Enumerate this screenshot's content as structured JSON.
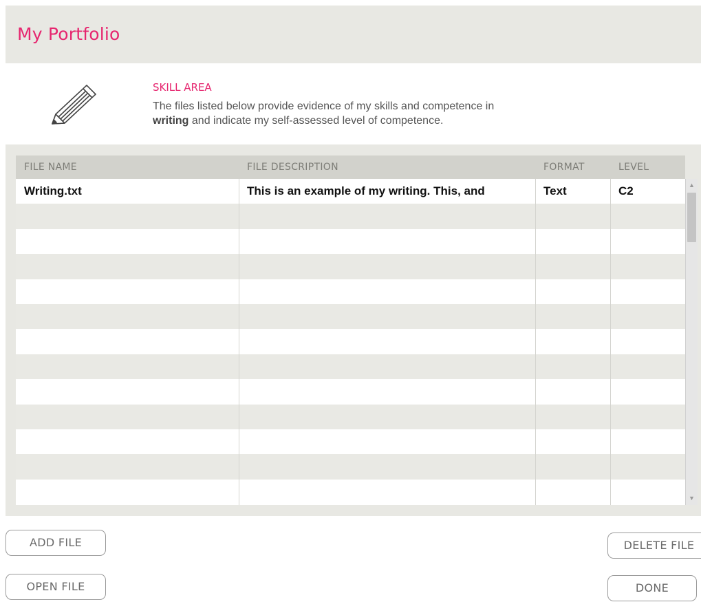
{
  "header": {
    "title": "My Portfolio"
  },
  "skill": {
    "icon": "pencil-icon",
    "heading": "SKILL AREA",
    "description_prefix": "The files listed below provide evidence of my skills and competence in",
    "skill_name": "writing",
    "description_suffix": "and indicate my self-assessed level of competence."
  },
  "table": {
    "columns": [
      "FILE NAME",
      "FILE DESCRIPTION",
      "FORMAT",
      "LEVEL"
    ],
    "rows": [
      {
        "file_name": "Writing.txt",
        "description": "This is an example of my writing. This, and",
        "format": "Text",
        "level": "C2"
      }
    ]
  },
  "buttons": {
    "add_file": "ADD FILE",
    "open_file": "OPEN FILE",
    "delete_file": "DELETE FILE",
    "done": "DONE"
  },
  "colors": {
    "accent": "#e6266f",
    "panel": "#e8e8e3",
    "header_row": "#d2d2cc"
  }
}
